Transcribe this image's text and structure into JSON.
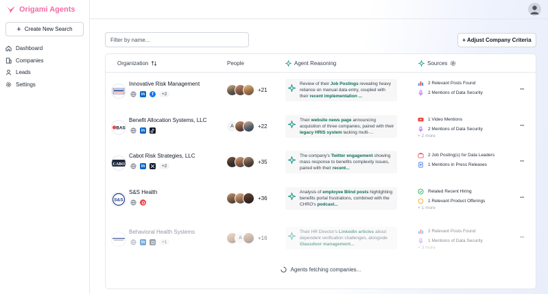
{
  "app": {
    "name": "Origami Agents"
  },
  "sidebar": {
    "create_label": "Create New Search",
    "items": [
      {
        "label": "Dashboard",
        "icon": "home-icon"
      },
      {
        "label": "Companies",
        "icon": "building-icon"
      },
      {
        "label": "Leads",
        "icon": "user-icon"
      },
      {
        "label": "Settings",
        "icon": "gear-icon"
      }
    ]
  },
  "toolbar": {
    "filter_placeholder": "Filter by name...",
    "adjust_label": "+ Adjust Company Criteria"
  },
  "table": {
    "headers": {
      "organization": "Organization",
      "people": "People",
      "reasoning": "Agent Reasoning",
      "sources": "Sources"
    },
    "rows": [
      {
        "name": "Innovative Risk Management",
        "badge": "+2",
        "people_count": "+21",
        "reasoning": [
          {
            "t": "Review of their "
          },
          {
            "t": "Job Postings",
            "b": true
          },
          {
            "t": " revealing heavy reliance on manual data entry, coupled with their "
          },
          {
            "t": "recent implementation ...",
            "b": true
          }
        ],
        "sources": [
          "2 Relevant Posts Found",
          "2 Mentions of Data Security"
        ],
        "more": ""
      },
      {
        "name": "Benefit Allocation Systems, LLC",
        "badge": "",
        "people_count": "+22",
        "reasoning": [
          {
            "t": "Their "
          },
          {
            "t": "website news page",
            "b": true
          },
          {
            "t": " announcing acquisition of three companies, paired with their "
          },
          {
            "t": "legacy HRIS system",
            "b": true
          },
          {
            "t": " lacking multi-..."
          }
        ],
        "sources": [
          "1 Video Mentions",
          "2 Mentions of Data Security"
        ],
        "more": "+ 2 more"
      },
      {
        "name": "Cabot Risk Strategies, LLC",
        "badge": "+2",
        "people_count": "+35",
        "reasoning": [
          {
            "t": "The company's "
          },
          {
            "t": "Twitter engagement",
            "b": true
          },
          {
            "t": " showing mass response to benefits complexity issues, paired with their "
          },
          {
            "t": "recent...",
            "b": true
          }
        ],
        "sources": [
          "2 Job Posting(s) for Data Leaders",
          "1 Mentions in Press Releases"
        ],
        "more": ""
      },
      {
        "name": "S&S Health",
        "badge": "",
        "people_count": "+36",
        "reasoning": [
          {
            "t": "Analysis of "
          },
          {
            "t": "employee Blind posts",
            "b": true
          },
          {
            "t": " highlighting benefits portal frustrations, combined with the CHRO's "
          },
          {
            "t": "podcast...",
            "b": true
          }
        ],
        "sources": [
          "Related Recent Hiring",
          "1 Relevant Product Offerings"
        ],
        "more": "+ 1 more"
      },
      {
        "name": "Behavioral Health Systems",
        "badge": "+1",
        "people_count": "+16",
        "reasoning": [
          {
            "t": "Their HR Director's "
          },
          {
            "t": "LinkedIn articles",
            "b": true
          },
          {
            "t": " about dependent verification challenges, alongside "
          },
          {
            "t": "Glassdoor management...",
            "b": true
          }
        ],
        "sources": [
          "2 Relevant Posts Found",
          "1 Mentions of Data Security"
        ],
        "more": "+ 3 more"
      }
    ]
  },
  "loading_text": "Agents fetching companies...",
  "colors": {
    "brand": "#f26ba6",
    "accent_green": "#0b6b5a",
    "linkedin": "#0a66c2"
  }
}
